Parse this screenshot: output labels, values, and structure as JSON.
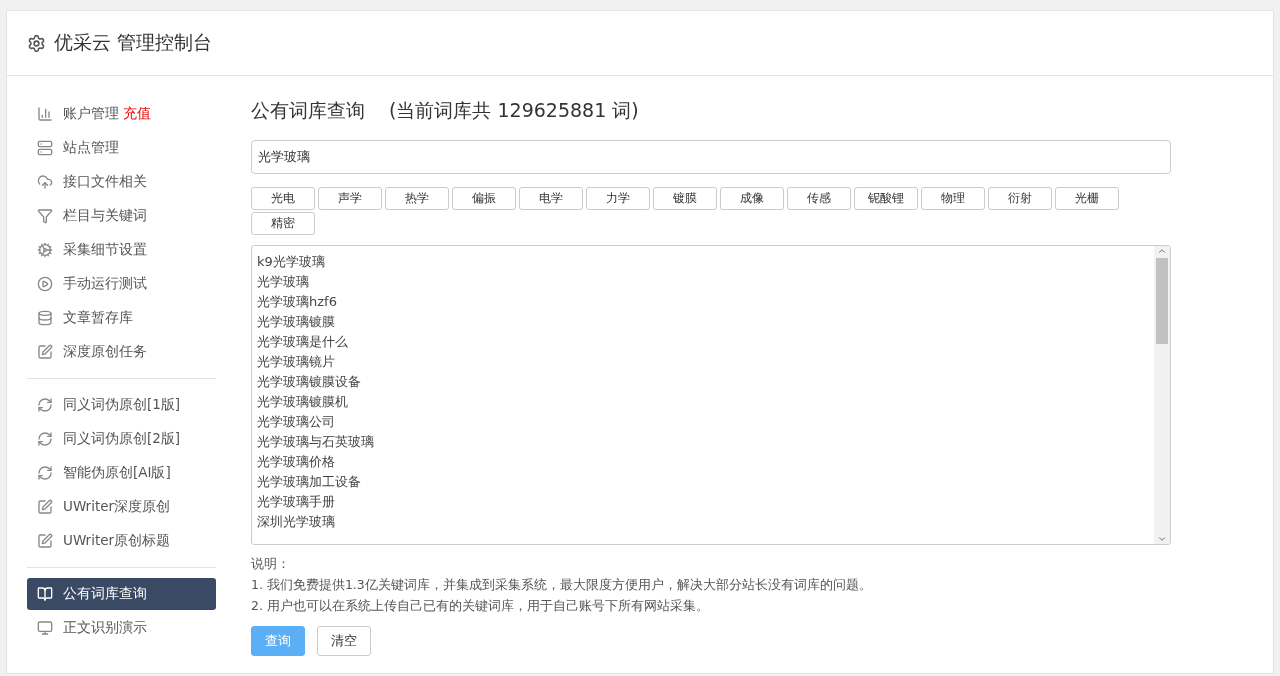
{
  "header": {
    "title": "优采云 管理控制台"
  },
  "sidebar": {
    "groups": [
      {
        "items": [
          {
            "label": "账户管理",
            "badge": "充值",
            "selected": false
          },
          {
            "label": "站点管理",
            "selected": false
          },
          {
            "label": "接口文件相关",
            "selected": false
          },
          {
            "label": "栏目与关键词",
            "selected": false
          },
          {
            "label": "采集细节设置",
            "selected": false
          },
          {
            "label": "手动运行测试",
            "selected": false
          },
          {
            "label": "文章暂存库",
            "selected": false
          },
          {
            "label": "深度原创任务",
            "selected": false
          }
        ]
      },
      {
        "items": [
          {
            "label": "同义词伪原创[1版]",
            "selected": false
          },
          {
            "label": "同义词伪原创[2版]",
            "selected": false
          },
          {
            "label": "智能伪原创[AI版]",
            "selected": false
          },
          {
            "label": "UWriter深度原创",
            "selected": false
          },
          {
            "label": "UWriter原创标题",
            "selected": false
          }
        ]
      },
      {
        "items": [
          {
            "label": "公有词库查询",
            "selected": true
          },
          {
            "label": "正文识别演示",
            "selected": false
          }
        ]
      }
    ]
  },
  "main": {
    "title": "公有词库查询",
    "count_text": "(当前词库共 129625881 词)",
    "search": {
      "value": "光学玻璃"
    },
    "tags": [
      "光电",
      "声学",
      "热学",
      "偏振",
      "电学",
      "力学",
      "镀膜",
      "成像",
      "传感",
      "铌酸锂",
      "物理",
      "衍射",
      "光栅",
      "精密"
    ],
    "results": [
      "k9光学玻璃",
      "光学玻璃",
      "光学玻璃hzf6",
      "光学玻璃镀膜",
      "光学玻璃是什么",
      "光学玻璃镜片",
      "光学玻璃镀膜设备",
      "光学玻璃镀膜机",
      "光学玻璃公司",
      "光学玻璃与石英玻璃",
      "光学玻璃价格",
      "光学玻璃加工设备",
      "光学玻璃手册",
      "深圳光学玻璃"
    ],
    "notes_title": "说明：",
    "notes": [
      "1. 我们免费提供1.3亿关键词库，并集成到采集系统，最大限度方便用户，解决大部分站长没有词库的问题。",
      "2. 用户也可以在系统上传自己已有的关键词库，用于自己账号下所有网站采集。"
    ],
    "buttons": [
      {
        "label": "查询",
        "kind": "primary"
      },
      {
        "label": "清空",
        "kind": "default"
      }
    ]
  }
}
